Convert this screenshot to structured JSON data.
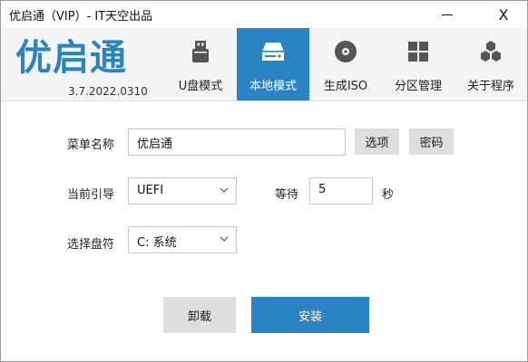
{
  "window": {
    "title": "优启通（VIP）- IT天空出品",
    "minimize_label": "—",
    "close_label": "X"
  },
  "header": {
    "logo_text": "优启通",
    "version": "3.7.2022.0310",
    "tabs": [
      {
        "label": "U盘模式",
        "icon": "usb-drive-icon",
        "active": false
      },
      {
        "label": "本地模式",
        "icon": "hard-drive-icon",
        "active": true
      },
      {
        "label": "生成ISO",
        "icon": "disc-icon",
        "active": false
      },
      {
        "label": "分区管理",
        "icon": "grid-icon",
        "active": false
      },
      {
        "label": "关于程序",
        "icon": "hexagons-icon",
        "active": false
      }
    ]
  },
  "form": {
    "menu_name_label": "菜单名称",
    "menu_name_value": "优启通",
    "options_button": "选项",
    "password_button": "密码",
    "boot_label": "当前引导",
    "boot_value": "UEFI",
    "wait_label": "等待",
    "wait_value": "5",
    "seconds_label": "秒",
    "disk_label": "选择盘符",
    "disk_value": "C: 系统"
  },
  "actions": {
    "uninstall_label": "卸载",
    "install_label": "安装"
  },
  "colors": {
    "accent": "#2a84c4",
    "header_bg": "#f4f4f4",
    "button_gray": "#dedede"
  }
}
